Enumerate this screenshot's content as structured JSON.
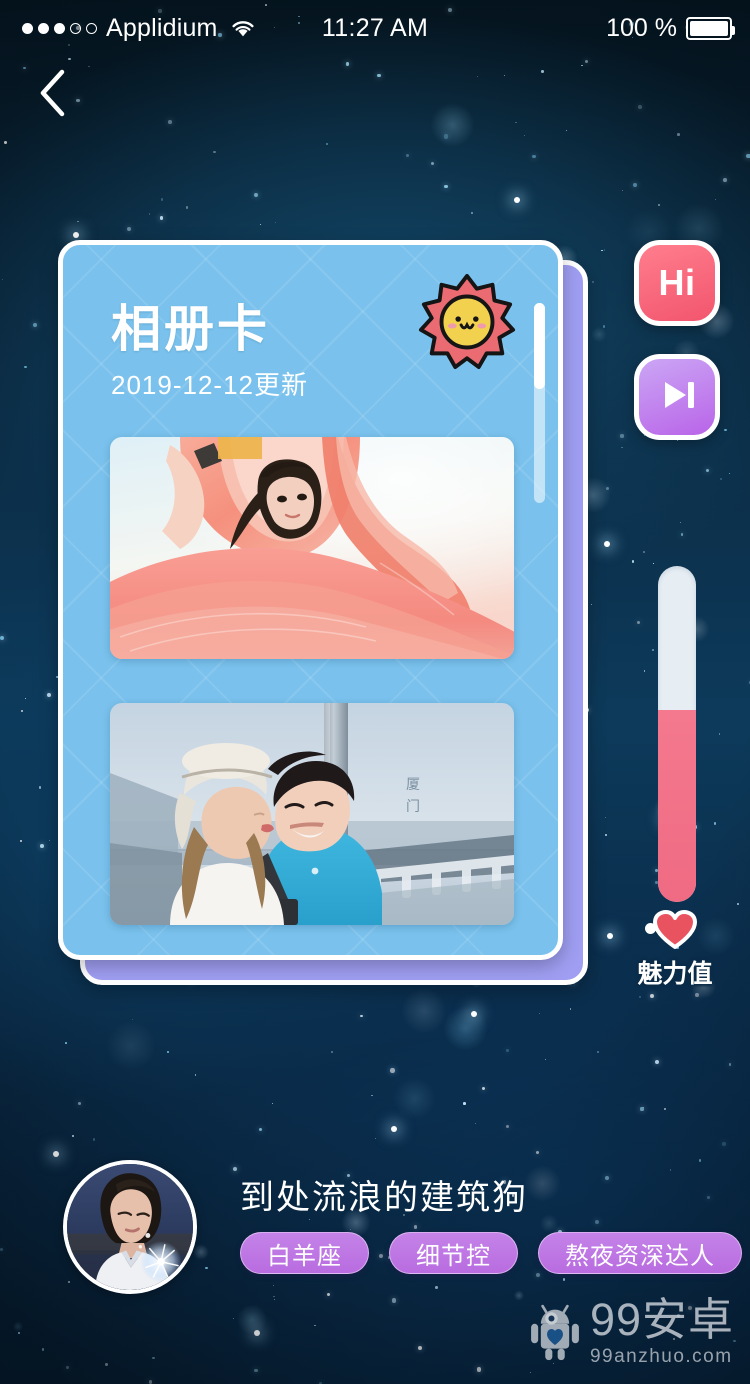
{
  "statusbar": {
    "carrier": "Applidium",
    "time": "11:27 AM",
    "battery": "100 %",
    "signal_filled": 3,
    "signal_empty": 2,
    "wifi_icon": "wifi-icon",
    "battery_icon": "battery-icon"
  },
  "nav": {
    "back_icon": "back-chevron-icon"
  },
  "album_card": {
    "title": "相册卡",
    "subtitle": "2019-12-12更新",
    "sticker_icon": "sun-face-sticker-icon",
    "card_color": "#7ac2ed",
    "stack_back_color": "#9f9ef2",
    "scroll_position_percent": 0,
    "photos": [
      {
        "alt": "girl-with-pink-fabric"
      },
      {
        "alt": "couple-on-bridge",
        "overlay_text": "厦门"
      }
    ]
  },
  "side_actions": [
    {
      "name": "hi-button",
      "label": "Hi",
      "color": "#f2556e"
    },
    {
      "name": "next-button",
      "label": "",
      "icon": "skip-next-icon",
      "color": "#b964e8"
    }
  ],
  "charm_meter": {
    "label": "魅力值",
    "icon": "heart-icon",
    "value_percent": 57,
    "fill_color": "#ef6b83",
    "track_color": "#e6eef4"
  },
  "profile": {
    "avatar_icon": "user-avatar",
    "name": "到处流浪的建筑狗",
    "tags": [
      "白羊座",
      "细节控",
      "熬夜资深达人"
    ],
    "tag_color": "#b96ce0"
  },
  "watermark": {
    "logo_icon": "android-robot-logo",
    "title": "99安卓",
    "url": "99anzhuo.com"
  }
}
